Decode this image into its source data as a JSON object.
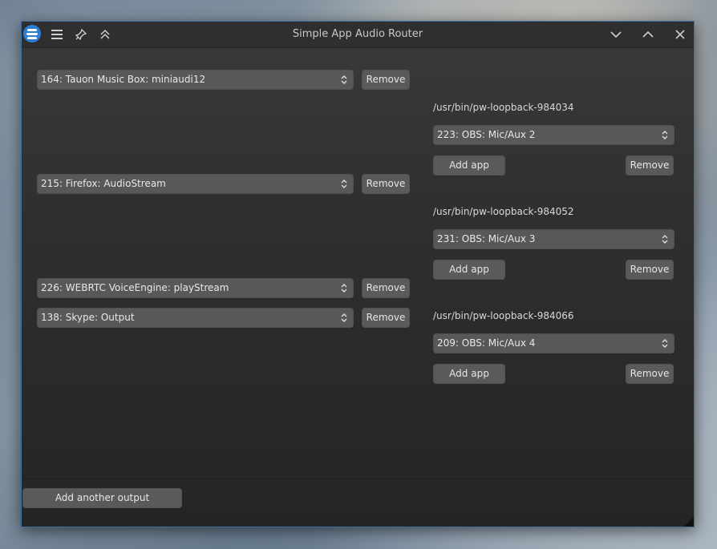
{
  "window": {
    "title": "Simple App Audio Router",
    "titlebar_icons": [
      "app-logo-icon",
      "hamburger-menu-icon",
      "pin-icon",
      "keep-above-icon",
      "minimize-icon",
      "maximize-icon",
      "close-icon"
    ]
  },
  "groups": [
    {
      "apps": [
        {
          "value": "164: Tauon Music Box: miniaudi12",
          "remove_label": "Remove"
        }
      ],
      "output_path": "/usr/bin/pw-loopback-984034",
      "output_target": "223: OBS: Mic/Aux 2",
      "add_app_label": "Add app",
      "remove_label": "Remove"
    },
    {
      "apps": [
        {
          "value": "215: Firefox: AudioStream",
          "remove_label": "Remove"
        }
      ],
      "output_path": "/usr/bin/pw-loopback-984052",
      "output_target": "231: OBS: Mic/Aux 3",
      "add_app_label": "Add app",
      "remove_label": "Remove"
    },
    {
      "apps": [
        {
          "value": "226: WEBRTC VoiceEngine: playStream",
          "remove_label": "Remove"
        },
        {
          "value": "138: Skype: Output",
          "remove_label": "Remove"
        }
      ],
      "output_path": "/usr/bin/pw-loopback-984066",
      "output_target": "209: OBS: Mic/Aux 4",
      "add_app_label": "Add app",
      "remove_label": "Remove"
    }
  ],
  "footer": {
    "add_output_label": "Add another output"
  },
  "colors": {
    "accent": "#2b7fd6",
    "window_border": "#3d6fa0"
  }
}
